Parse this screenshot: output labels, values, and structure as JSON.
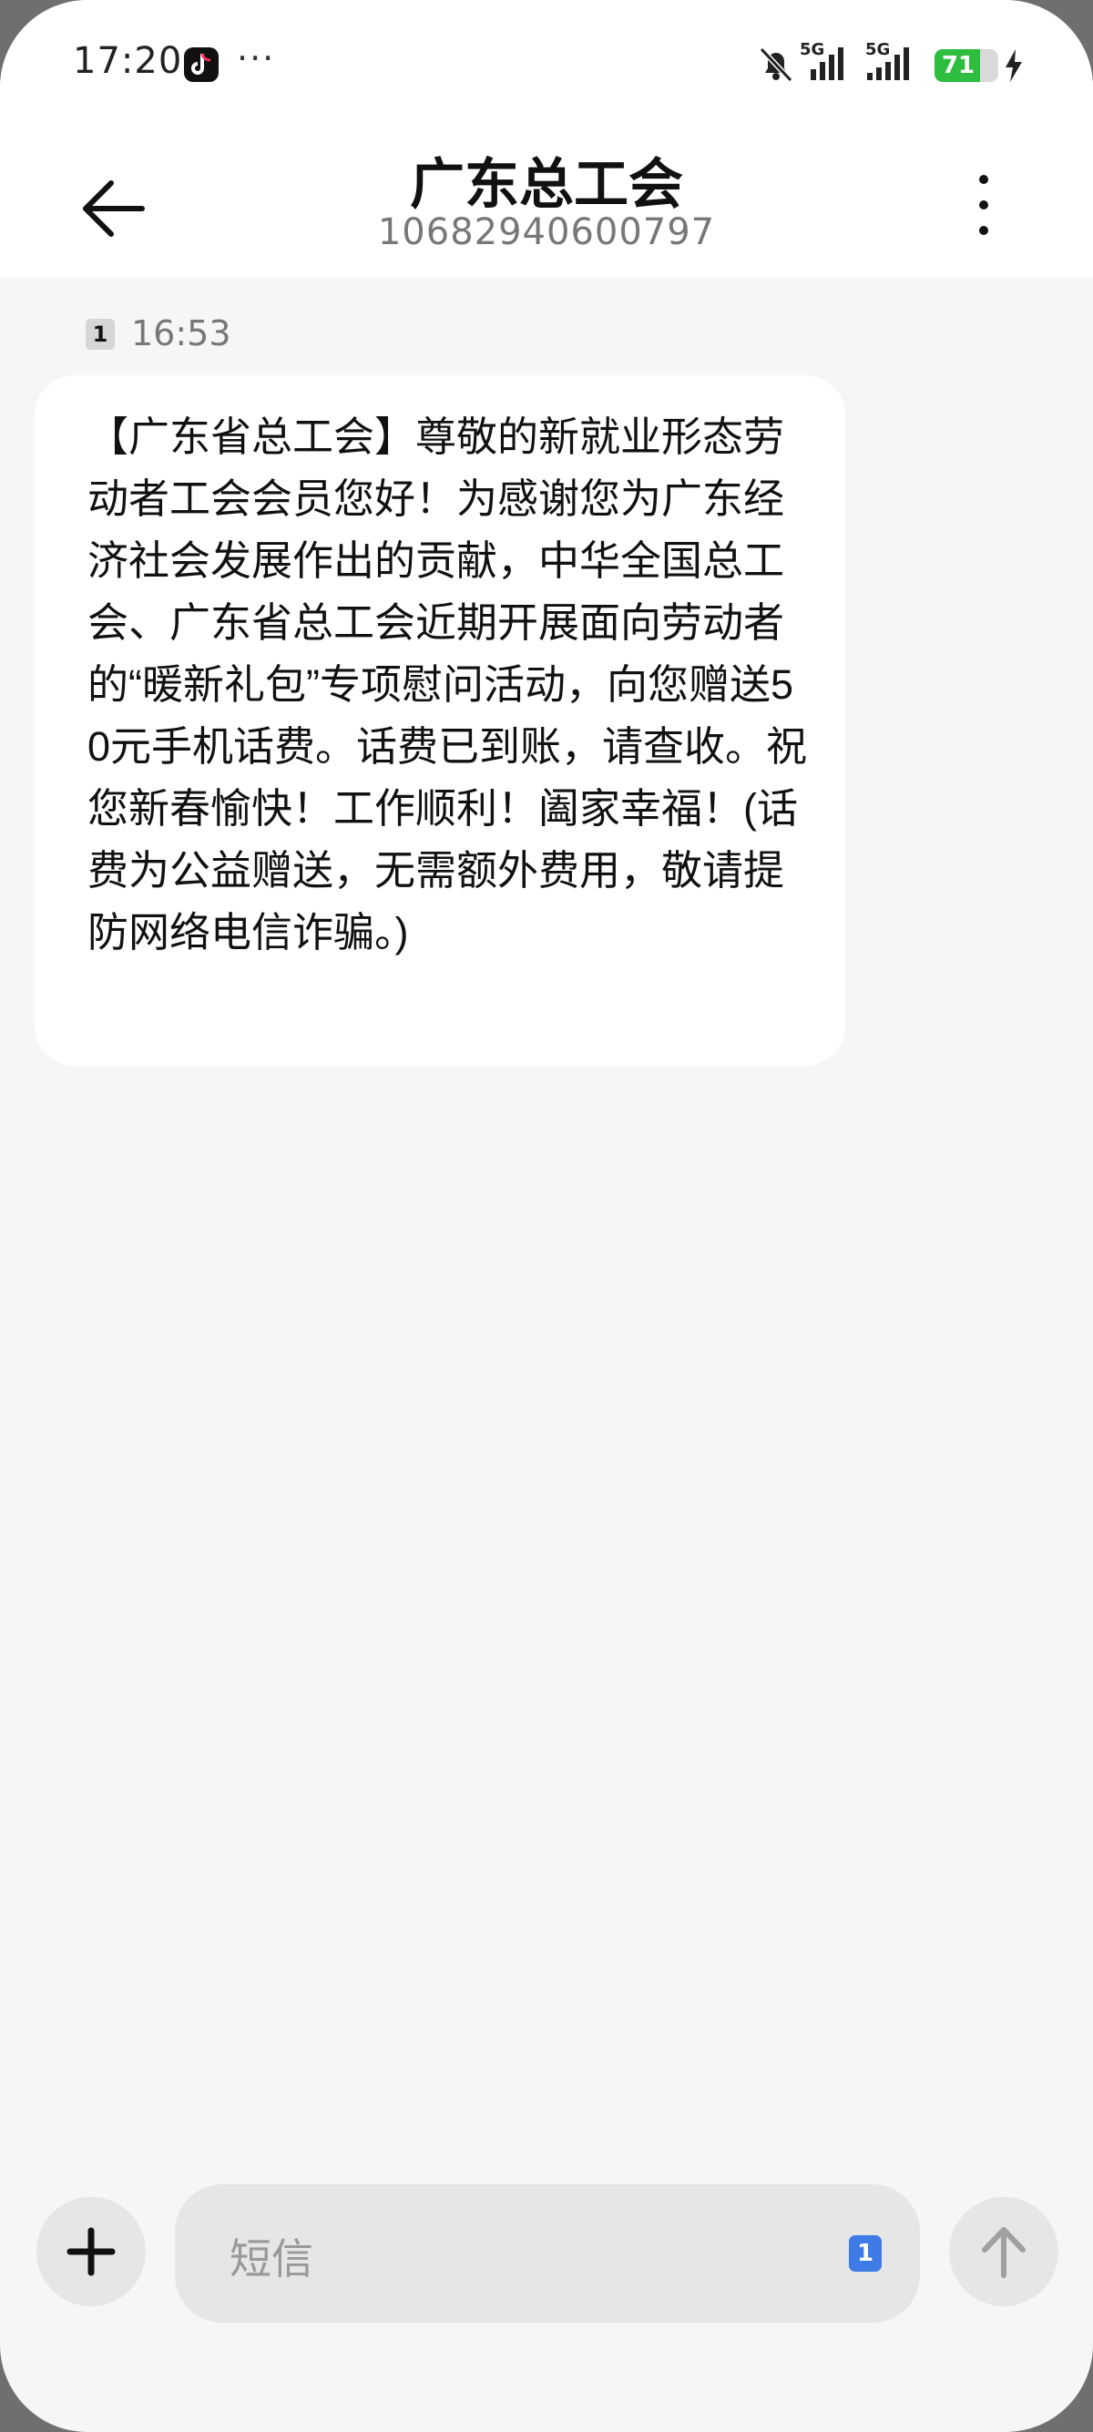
{
  "status_bar": {
    "time": "17:20",
    "more": "···",
    "signal1_label": "5G",
    "signal2_label": "5G",
    "battery_level": "71",
    "battery_fraction": 0.71,
    "battery_color": "#2dbd3f",
    "icons": [
      "tiktok-icon",
      "mute-bell-icon",
      "signal-icon",
      "battery-icon",
      "charging-bolt-icon"
    ]
  },
  "header": {
    "title": "广东总工会",
    "number": "10682940600797"
  },
  "message": {
    "sim": "1",
    "time": "16:53",
    "text": "【广东省总工会】尊敬的新就业形态劳动者工会会员您好！为感谢您为广东经济社会发展作出的贡献，中华全国总工会、广东省总工会近期开展面向劳动者的“暖新礼包”专项慰问活动，向您赠送50元手机话费。话费已到账，请查收。祝您新春愉快！工作顺利！阖家幸福！(话费为公益赠送，无需额外费用，敬请提防网络电信诈骗。)"
  },
  "composer": {
    "placeholder": "短信",
    "sim": "1",
    "accent_color": "#3f7be6"
  }
}
